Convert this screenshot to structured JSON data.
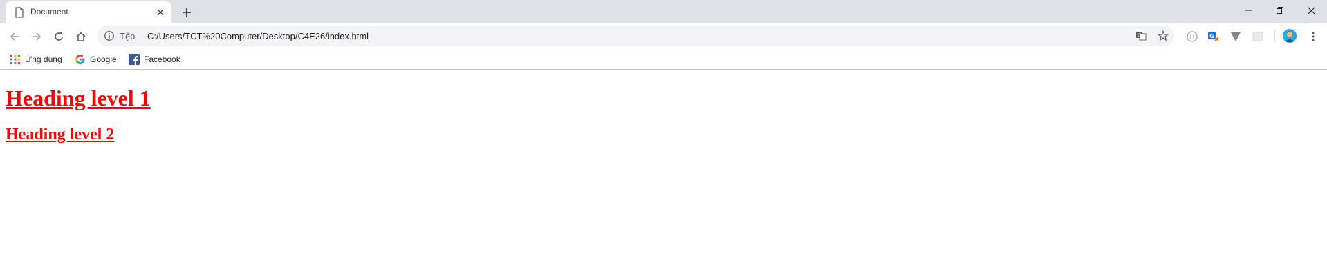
{
  "browser": {
    "tab": {
      "title": "Document",
      "favicon": "document-icon"
    },
    "new_tab_icon": "plus-icon",
    "window_controls": [
      "minimize-icon",
      "restore-icon",
      "close-icon"
    ],
    "toolbar": {
      "back_icon": "arrow-left-icon",
      "forward_icon": "arrow-right-icon",
      "reload_icon": "reload-icon",
      "home_icon": "home-icon"
    },
    "omnibox": {
      "info_icon": "info-icon",
      "scheme_label": "Tệp",
      "url": "C:/Users/TCT%20Computer/Desktop/C4E26/index.html",
      "translate_icon": "translate-icon",
      "bookmark_icon": "star-icon"
    },
    "extensions": [
      "extension-circle-icon",
      "extension-translate-icon",
      "extension-v-icon",
      "extension-square-icon"
    ],
    "profile_icon": "avatar-icon",
    "menu_icon": "more-vertical-icon"
  },
  "bookmarks": [
    {
      "label": "Ứng dụng",
      "icon": "apps-grid-icon"
    },
    {
      "label": "Google",
      "icon": "google-icon"
    },
    {
      "label": "Facebook",
      "icon": "facebook-icon"
    }
  ],
  "page": {
    "heading1": "Heading level 1",
    "heading2": "Heading level 2",
    "heading_color": "#ff0000"
  },
  "colors": {
    "tabstrip_bg": "#dee1e6",
    "omnibox_bg": "#f1f3f4"
  }
}
